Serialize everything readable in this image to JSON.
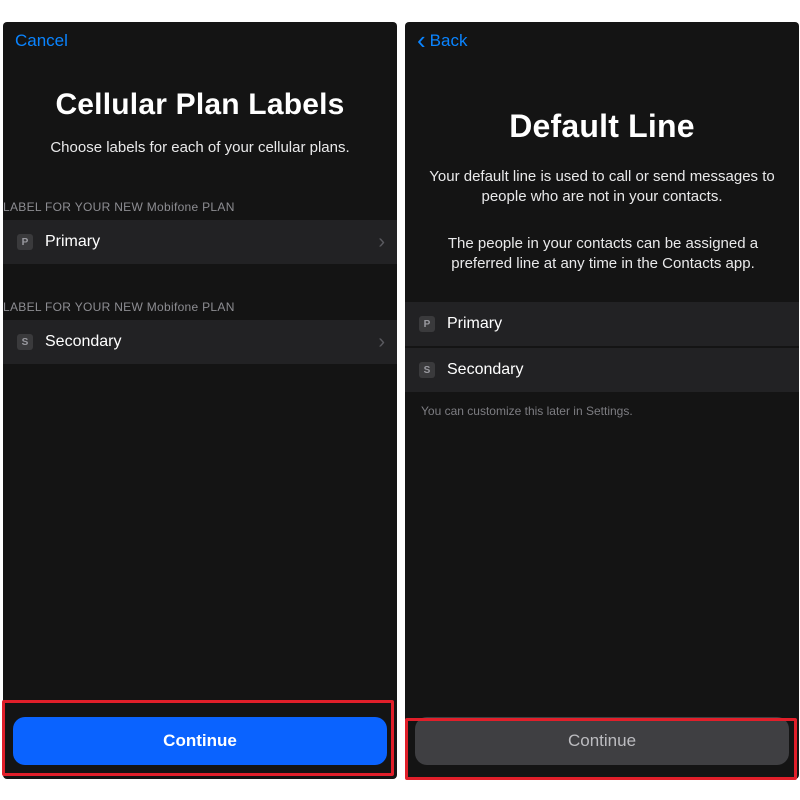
{
  "left": {
    "cancel": "Cancel",
    "title": "Cellular Plan Labels",
    "subtitle": "Choose labels for each of your cellular plans.",
    "section_label": "LABEL FOR YOUR NEW Mobifone PLAN",
    "primary_label": "Primary",
    "secondary_label": "Secondary",
    "continue": "Continue",
    "badge_p": "P",
    "badge_s": "S"
  },
  "right": {
    "back": "Back",
    "title": "Default Line",
    "subtitle": "Your default line is used to call or send messages to people who are not in your contacts.",
    "subtitle2": "The people in your contacts can be assigned a preferred line at any time in the Contacts app.",
    "primary_label": "Primary",
    "secondary_label": "Secondary",
    "footnote": "You can customize this later in Settings.",
    "continue": "Continue",
    "badge_p": "P",
    "badge_s": "S"
  }
}
